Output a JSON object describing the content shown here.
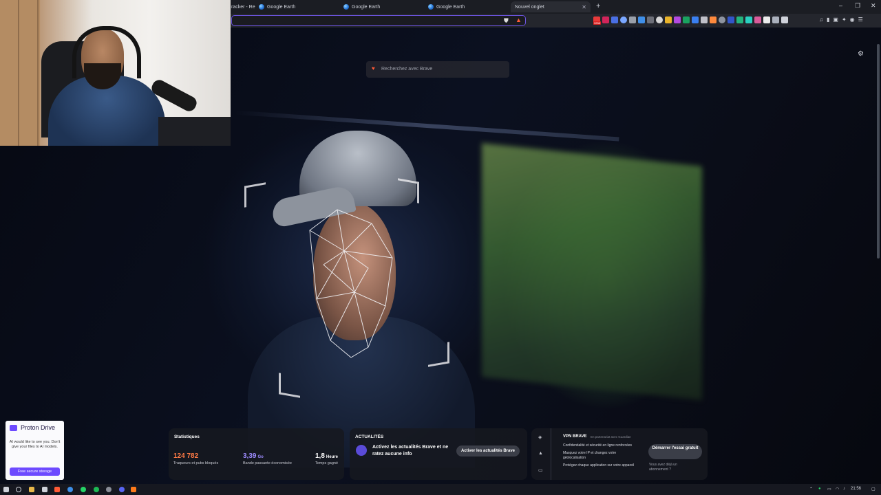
{
  "tabs": [
    {
      "label": "racker - Re",
      "active": false
    },
    {
      "label": "Google Earth",
      "active": false
    },
    {
      "label": "Google Earth",
      "active": false
    },
    {
      "label": "Google Earth",
      "active": false
    },
    {
      "label": "Nouvel onglet",
      "active": true
    }
  ],
  "toolbar": {
    "ext_badge": "3258"
  },
  "search": {
    "placeholder": "Recherchez avec Brave"
  },
  "stats": {
    "title": "Statistiques",
    "trackers_value": "124 782",
    "trackers_label": "Traqueurs et pubs bloqués",
    "bandwidth_value": "3,39",
    "bandwidth_unit": "Go",
    "bandwidth_label": "Bande passante économisée",
    "time_value": "1,8",
    "time_unit": "Heure",
    "time_label": "Temps gagné",
    "colors": {
      "trackers": "#ff7a45",
      "bandwidth": "#9d8cff",
      "time": "#ffffff"
    }
  },
  "news": {
    "title": "ACTUALITÉS",
    "message": "Activez les actualités Brave et ne ratez aucune info",
    "button": "Activer les actualités Brave"
  },
  "vpn": {
    "title": "VPN BRAVE",
    "partner": "En partenariat avec Guardian",
    "features": [
      "Confidentialité et sécurité en ligne renforcées",
      "Masquez votre IP et changez votre géolocalisation",
      "Protégez chaque application sur votre appareil"
    ],
    "button": "Démarrer l'essai gratuit",
    "subscribed": "Vous avez déjà un abonnement ?"
  },
  "proton": {
    "name": "Proton Drive",
    "message": "AI would like to see you. Don't give your files to AI models.",
    "cta": "Free secure storage",
    "accent": "#6d4aff"
  },
  "taskbar": {
    "clock": "21:56"
  },
  "accent": "#6d55e0"
}
